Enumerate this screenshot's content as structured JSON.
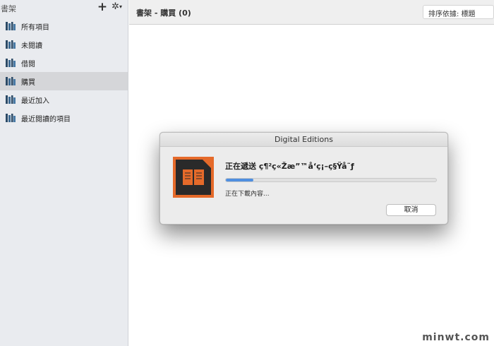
{
  "sidebar": {
    "title": "書架",
    "add_icon": "plus-icon",
    "settings_icon": "gear-icon",
    "items": [
      {
        "label": "所有項目",
        "icon": "bookshelf-icon",
        "selected": false
      },
      {
        "label": "未閱讀",
        "icon": "bookshelf-icon",
        "selected": false
      },
      {
        "label": "借閱",
        "icon": "bookshelf-icon",
        "selected": false
      },
      {
        "label": "購買",
        "icon": "bookshelf-icon",
        "selected": true
      },
      {
        "label": "最近加入",
        "icon": "bookshelf-icon",
        "selected": false
      },
      {
        "label": "最近閱讀的項目",
        "icon": "bookshelf-icon",
        "selected": false
      }
    ]
  },
  "header": {
    "title": "書架 - 購買 (0)",
    "sort_label": "排序依據: 標題"
  },
  "dialog": {
    "title": "Digital Editions",
    "filename": "正在遞送 ç¶²ç«Žæ”™å‘ç¡–ç§Ÿå˜ƒ",
    "status": "正在下載內容...",
    "progress": 0.13,
    "cancel_label": "取消",
    "icon": "book-icon"
  },
  "watermark": "minwt.com",
  "colors": {
    "accent": "#4f8fe0",
    "book_icon": "#e56a2a"
  }
}
